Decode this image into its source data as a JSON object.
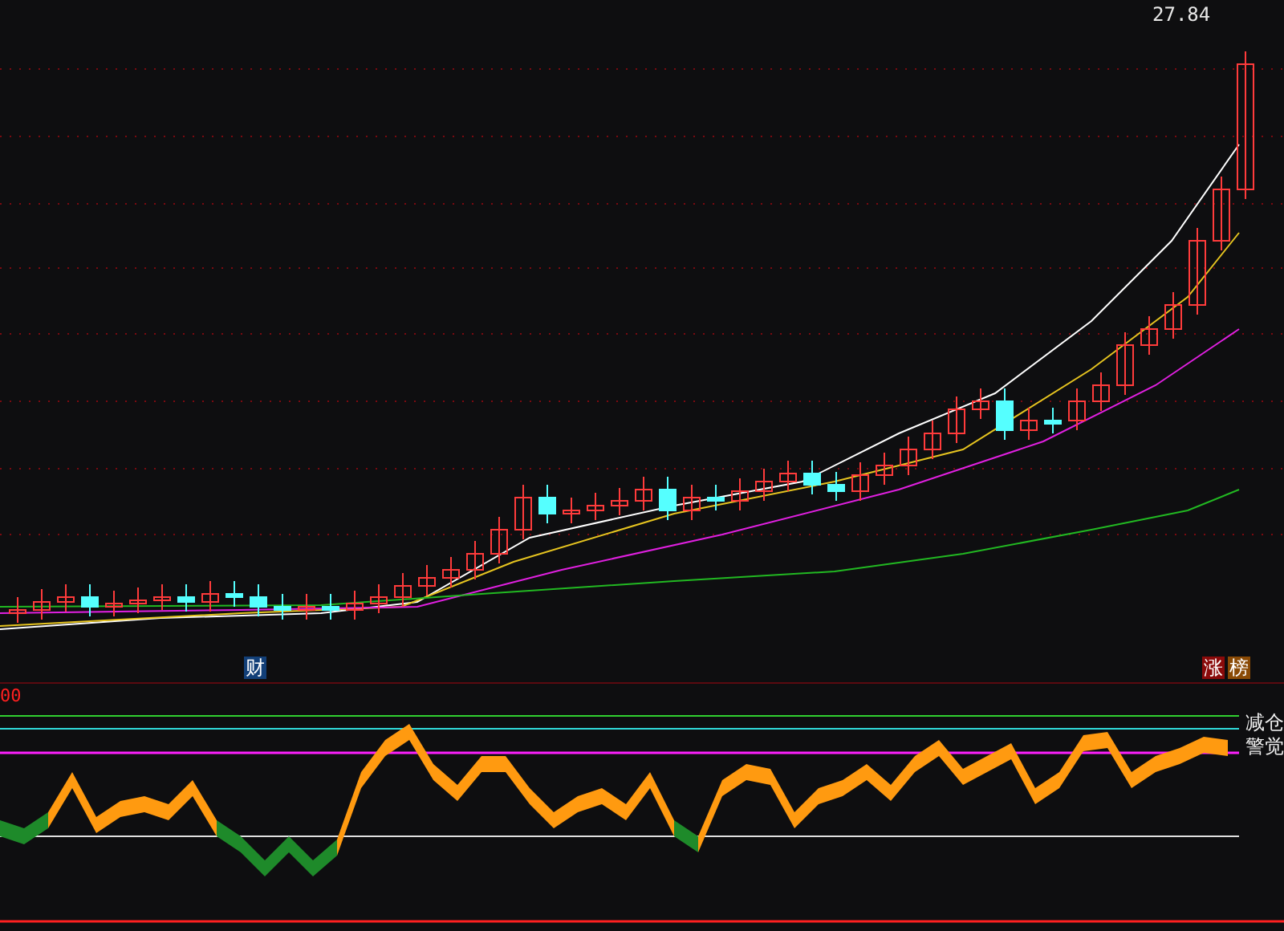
{
  "price_panel": {
    "last_price": "27.84",
    "left_badges": [
      {
        "label": "财",
        "color": "#123f78"
      }
    ],
    "right_badges": [
      {
        "label": "涨",
        "color": "#8a0a0a"
      },
      {
        "label": "榜",
        "color": "#8a4a05"
      }
    ]
  },
  "indicator_panel": {
    "value": "00",
    "labels": [
      "减仓",
      "警觉"
    ]
  }
}
